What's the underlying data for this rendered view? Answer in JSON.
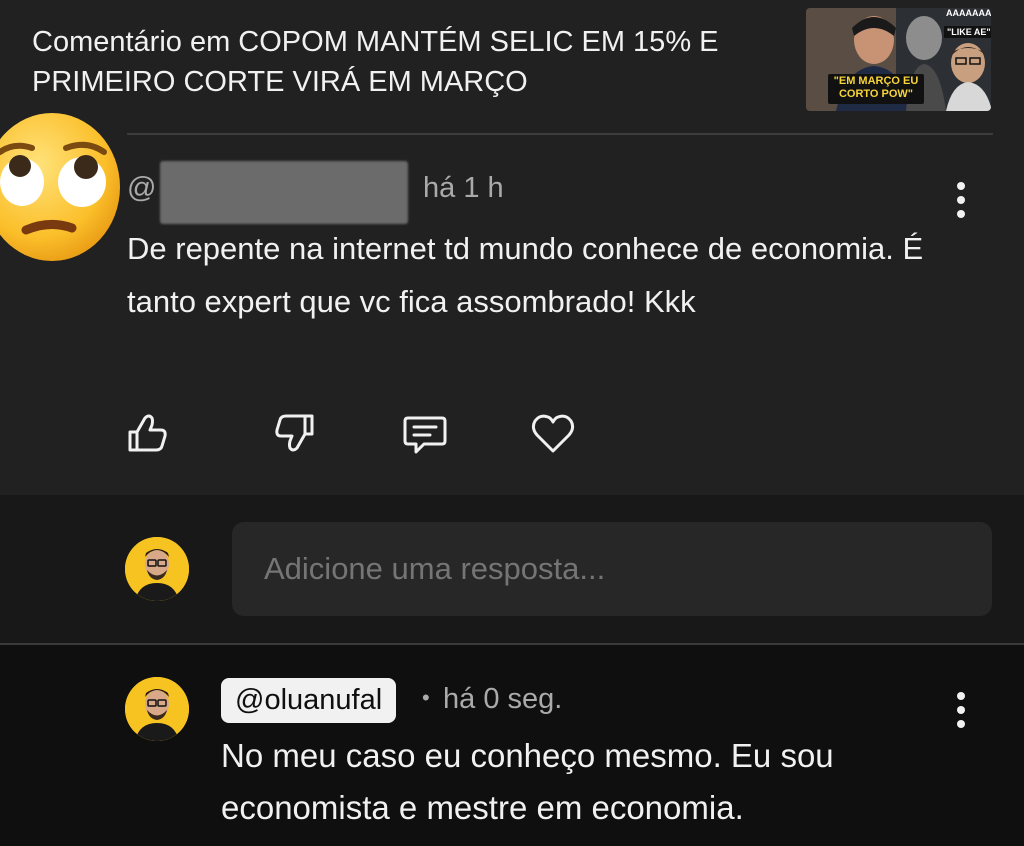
{
  "header": {
    "title": "Comentário em COPOM MANTÉM SELIC EM 15% E PRIMEIRO CORTE VIRÁ EM MARÇO",
    "thumbnail": {
      "caption": "\"EM MARÇO EU CORTO POW\"",
      "tag": "\"LIKE AE\"",
      "scream": "AAAAAAAA"
    }
  },
  "comment": {
    "handle_prefix": "@",
    "time": "há 1 h",
    "text": "De repente na internet td mundo conhece de economia. É tanto expert que vc fica assombrado! Kkk",
    "reaction_emoji": "eye-roll-face"
  },
  "reply_box": {
    "placeholder": "Adicione uma resposta..."
  },
  "reply": {
    "handle": "@oluanufal",
    "separator": "•",
    "time": "há 0 seg.",
    "text": "No meu caso eu conheço mesmo. Eu sou economista e mestre em economia."
  },
  "colors": {
    "background": "#0f0f0f",
    "card": "#212121",
    "text": "#f1f1f1",
    "muted": "#aaaaaa",
    "avatar_bg": "#f7c321"
  }
}
